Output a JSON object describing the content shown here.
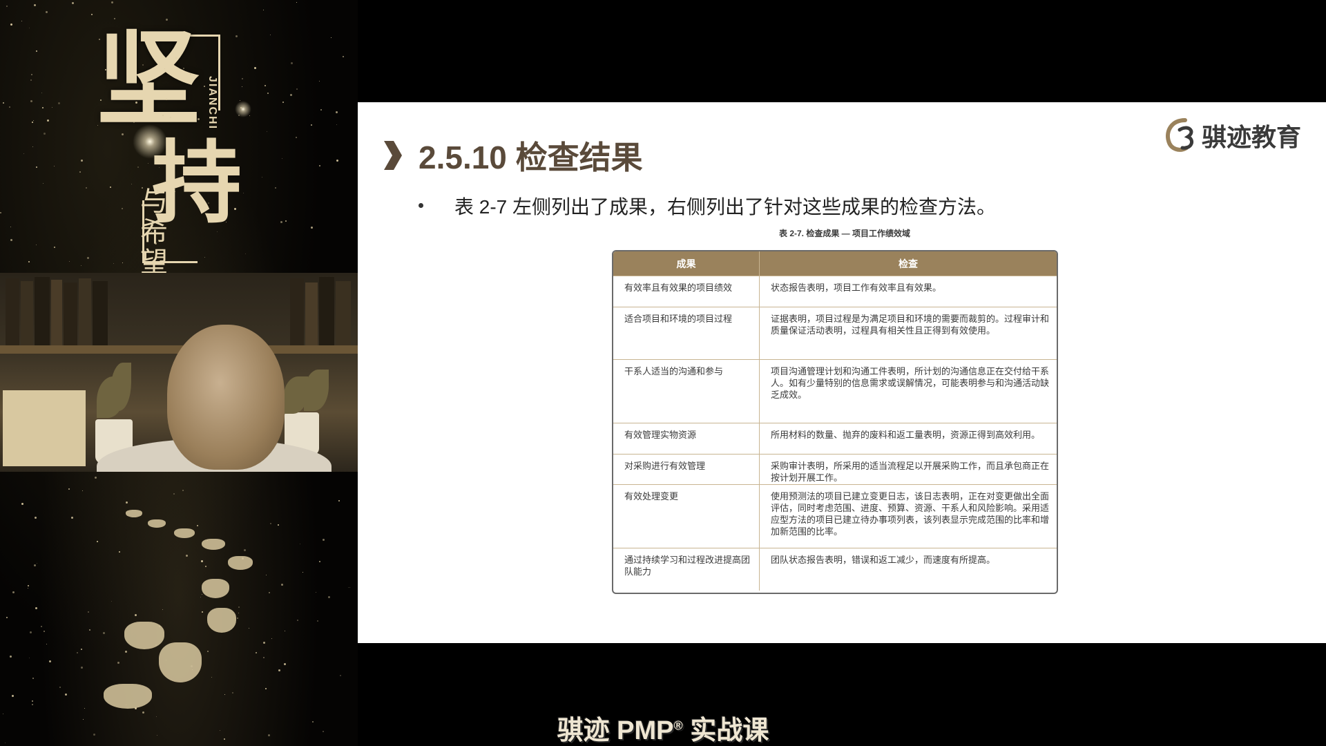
{
  "poster": {
    "title_char_1": "坚",
    "title_char_2": "持",
    "subtitle": "与希望",
    "pinyin": "JIANCHI"
  },
  "slide": {
    "heading": "2.5.10 检查结果",
    "brand_name": "骐迹教育",
    "bullet": "表 2-7 左侧列出了成果，右侧列出了针对这些成果的检查方法。",
    "table_caption": "表 2-7. 检查成果 — 项目工作绩效域",
    "table": {
      "headers": [
        "成果",
        "检查"
      ],
      "rows": [
        {
          "outcome": "有效率且有效果的项目绩效",
          "check": "状态报告表明，项目工作有效率且有效果。"
        },
        {
          "outcome": "适合项目和环境的项目过程",
          "check": "证据表明，项目过程是为满足项目和环境的需要而裁剪的。过程审计和质量保证活动表明，过程具有相关性且正得到有效使用。"
        },
        {
          "outcome": "干系人适当的沟通和参与",
          "check": "项目沟通管理计划和沟通工件表明，所计划的沟通信息正在交付给干系人。如有少量特别的信息需求或误解情况，可能表明参与和沟通活动缺乏成效。"
        },
        {
          "outcome": "有效管理实物资源",
          "check": "所用材料的数量、抛弃的废料和返工量表明，资源正得到高效利用。"
        },
        {
          "outcome": "对采购进行有效管理",
          "check": "采购审计表明，所采用的适当流程足以开展采购工作，而且承包商正在按计划开展工作。"
        },
        {
          "outcome": "有效处理变更",
          "check": "使用预测法的项目已建立变更日志，该日志表明，正在对变更做出全面评估，同时考虑范围、进度、预算、资源、干系人和风险影响。采用适应型方法的项目已建立待办事项列表，该列表显示完成范围的比率和增加新范围的比率。"
        },
        {
          "outcome": "通过持续学习和过程改进提高团队能力",
          "check": "团队状态报告表明，错误和返工减少，而速度有所提高。"
        }
      ]
    }
  },
  "footer": {
    "caption_prefix": "骐迹 PMP",
    "caption_mark": "®",
    "caption_suffix": " 实战课"
  },
  "colors": {
    "table_header": "#9a825c",
    "heading": "#5a4a3a",
    "poster_gold": "#e6d6b0"
  }
}
